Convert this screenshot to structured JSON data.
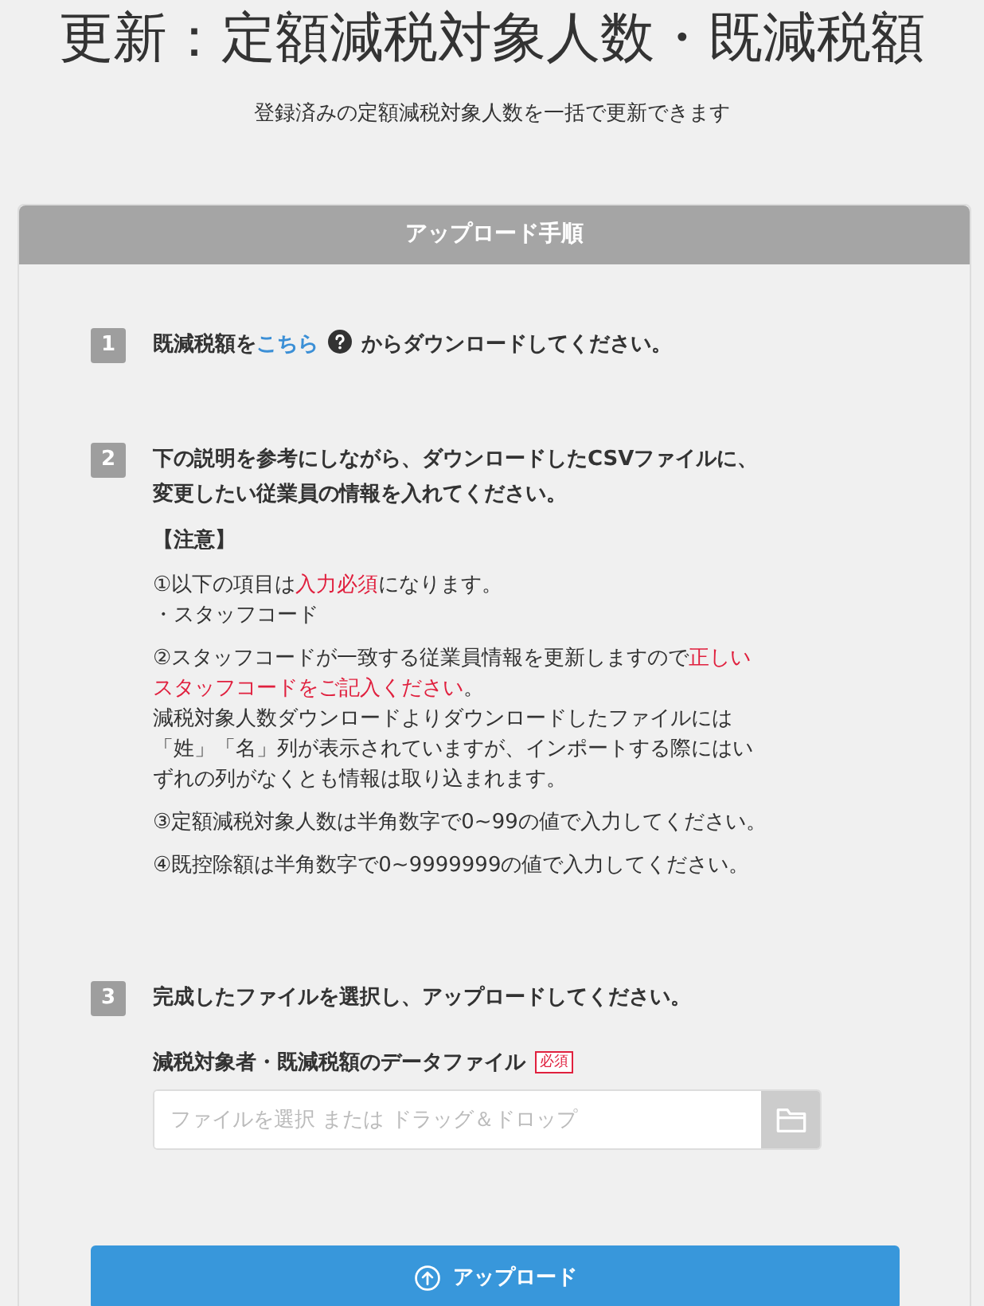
{
  "title": "更新：定額減税対象人数・既減税額",
  "subtitle": "登録済みの定額減税対象人数を一括で更新できます",
  "panel": {
    "header": "アップロード手順",
    "steps": [
      {
        "number": "1",
        "kind": "download",
        "segments": [
          {
            "kind": "text",
            "text": "既減税額を"
          },
          {
            "kind": "link",
            "text": "こちら"
          },
          {
            "kind": "help"
          },
          {
            "kind": "text",
            "text": "からダウンロードしてください。"
          }
        ]
      },
      {
        "number": "2",
        "kind": "notes",
        "lines": [
          "下の説明を参考にしながら、ダウンロードしたCSVファイルに、",
          "変更したい従業員の情報を入れてください。"
        ],
        "note_title": "【注意】",
        "notes": [
          [
            [
              {
                "text": "①以下の項目は",
                "emphasis": false
              },
              {
                "text": "入力必須",
                "emphasis": true
              },
              {
                "text": "になります。",
                "emphasis": false
              }
            ],
            [
              {
                "text": "・スタッフコード",
                "emphasis": false
              }
            ]
          ],
          [
            [
              {
                "text": "②スタッフコードが一致する従業員情報を更新しますので",
                "emphasis": false
              },
              {
                "text": "正しい",
                "emphasis": true
              }
            ],
            [
              {
                "text": "スタッフコードをご記入ください",
                "emphasis": true
              },
              {
                "text": "。",
                "emphasis": false
              }
            ],
            [
              {
                "text": "減税対象人数ダウンロードよりダウンロードしたファイルには",
                "emphasis": false
              }
            ],
            [
              {
                "text": "「姓」「名」列が表示されていますが、インポートする際にはい",
                "emphasis": false
              }
            ],
            [
              {
                "text": "ずれの列がなくとも情報は取り込まれます。",
                "emphasis": false
              }
            ]
          ],
          [
            [
              {
                "text": "③定額減税対象人数は半角数字で0~99の値で入力してください。",
                "emphasis": false
              }
            ]
          ],
          [
            [
              {
                "text": "④既控除額は半角数字で0~9999999の値で入力してください。",
                "emphasis": false
              }
            ]
          ]
        ]
      },
      {
        "number": "3",
        "kind": "upload",
        "text": "完成したファイルを選択し、アップロードしてください。",
        "field": {
          "label": "減税対象者・既減税額のデータファイル",
          "required_badge": "必須",
          "placeholder": "ファイルを選択 または ドラッグ＆ドロップ"
        }
      }
    ],
    "upload_button": "アップロード"
  }
}
